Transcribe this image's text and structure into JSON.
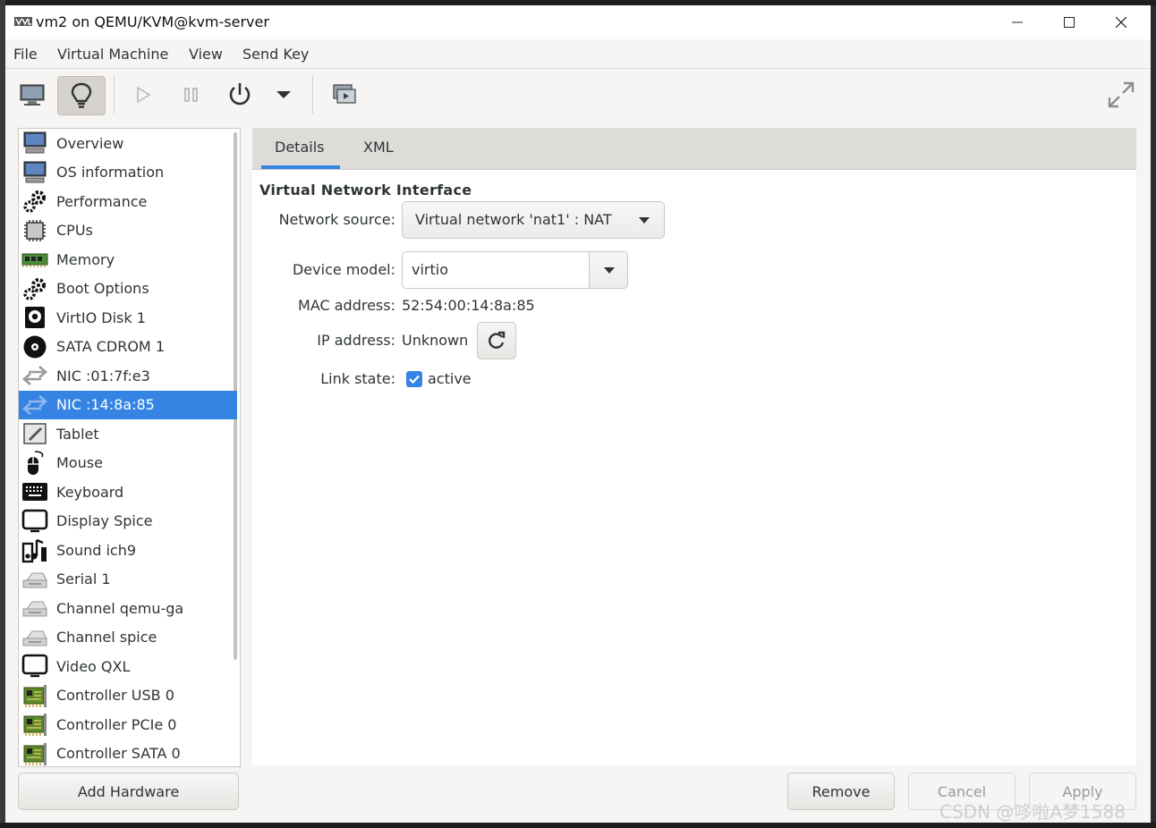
{
  "window": {
    "title": "vm2 on QEMU/KVM@kvm-server"
  },
  "menubar": [
    "File",
    "Virtual Machine",
    "View",
    "Send Key"
  ],
  "toolbar": {
    "buttons": [
      {
        "name": "console-button",
        "icon": "monitor-icon",
        "active": false
      },
      {
        "name": "details-button",
        "icon": "lightbulb-icon",
        "active": true
      },
      {
        "name": "run-button",
        "icon": "play-icon",
        "active": false
      },
      {
        "name": "pause-button",
        "icon": "pause-icon",
        "active": false
      },
      {
        "name": "shutdown-button",
        "icon": "power-icon",
        "active": false
      },
      {
        "name": "shutdown-menu-button",
        "icon": "chevron-down-icon",
        "active": false
      },
      {
        "name": "snapshots-button",
        "icon": "snapshots-icon",
        "active": false
      },
      {
        "name": "fullscreen-button",
        "icon": "expand-icon",
        "active": false
      }
    ]
  },
  "sidebar": {
    "items": [
      {
        "label": "Overview",
        "icon": "monitor-icon"
      },
      {
        "label": "OS information",
        "icon": "monitor-icon"
      },
      {
        "label": "Performance",
        "icon": "gears-icon"
      },
      {
        "label": "CPUs",
        "icon": "cpu-icon"
      },
      {
        "label": "Memory",
        "icon": "memory-icon"
      },
      {
        "label": "Boot Options",
        "icon": "gears-icon"
      },
      {
        "label": "VirtIO Disk 1",
        "icon": "disk-icon"
      },
      {
        "label": "SATA CDROM 1",
        "icon": "cdrom-icon"
      },
      {
        "label": "NIC :01:7f:e3",
        "icon": "nic-icon"
      },
      {
        "label": "NIC :14:8a:85",
        "icon": "nic-icon",
        "selected": true
      },
      {
        "label": "Tablet",
        "icon": "tablet-icon"
      },
      {
        "label": "Mouse",
        "icon": "mouse-icon"
      },
      {
        "label": "Keyboard",
        "icon": "keyboard-icon"
      },
      {
        "label": "Display Spice",
        "icon": "display-icon"
      },
      {
        "label": "Sound ich9",
        "icon": "sound-icon"
      },
      {
        "label": "Serial 1",
        "icon": "serial-icon"
      },
      {
        "label": "Channel qemu-ga",
        "icon": "serial-icon"
      },
      {
        "label": "Channel spice",
        "icon": "serial-icon"
      },
      {
        "label": "Video QXL",
        "icon": "display-icon"
      },
      {
        "label": "Controller USB 0",
        "icon": "controller-icon"
      },
      {
        "label": "Controller PCIe 0",
        "icon": "controller-icon"
      },
      {
        "label": "Controller SATA 0",
        "icon": "controller-icon"
      }
    ],
    "add_hardware": "Add Hardware"
  },
  "tabs": [
    "Details",
    "XML"
  ],
  "details": {
    "section_title": "Virtual Network Interface",
    "network_source_label": "Network source:",
    "network_source_value": "Virtual network 'nat1' : NAT",
    "device_model_label": "Device model:",
    "device_model_value": "virtio",
    "mac_label": "MAC address:",
    "mac_value": "52:54:00:14:8a:85",
    "ip_label": "IP address:",
    "ip_value": "Unknown",
    "link_label": "Link state:",
    "link_value": "active",
    "link_checked": true
  },
  "actions": {
    "remove": "Remove",
    "cancel": "Cancel",
    "apply": "Apply"
  },
  "watermark": "CSDN @哆啦A梦1588",
  "colors": {
    "accent": "#3584e4",
    "bg": "#f6f5f4"
  }
}
